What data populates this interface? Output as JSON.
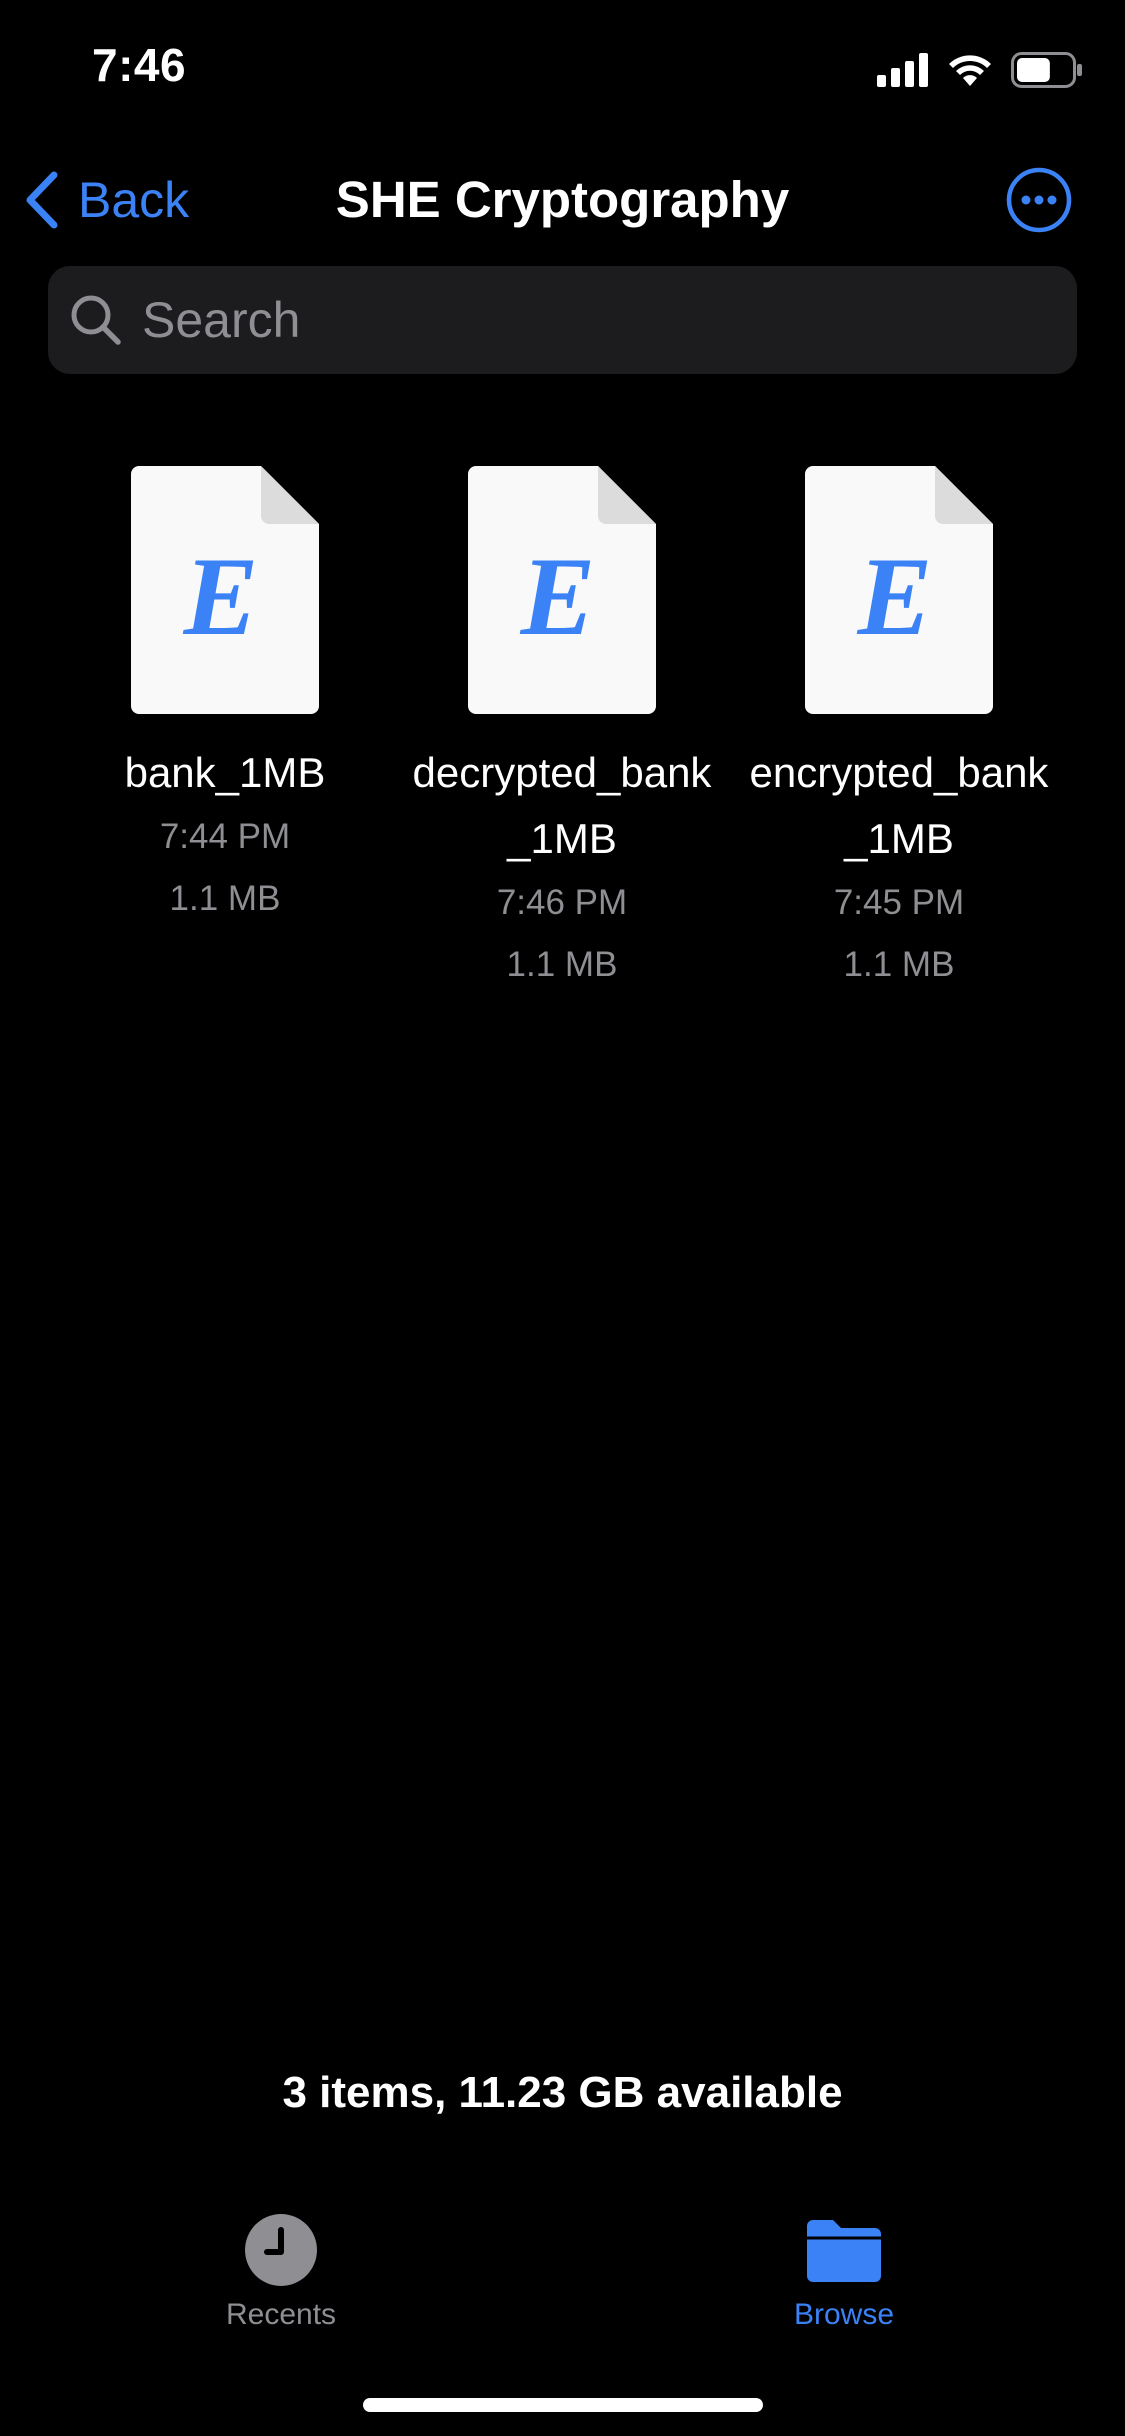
{
  "status_bar": {
    "time": "7:46",
    "battery_level": 0.62,
    "icons": [
      "cellular-signal-icon",
      "wifi-icon",
      "battery-icon"
    ]
  },
  "nav": {
    "back_label": "Back",
    "title": "SHE Cryptography",
    "more_icon": "ellipsis-circle-icon"
  },
  "search": {
    "placeholder": "Search",
    "value": ""
  },
  "files": [
    {
      "name": "bank_1MB",
      "time": "7:44 PM",
      "size": "1.1 MB",
      "icon_letter": "E"
    },
    {
      "name": "decrypted_bank_1MB",
      "time": "7:46 PM",
      "size": "1.1 MB",
      "icon_letter": "E"
    },
    {
      "name": "encrypted_bank_1MB",
      "time": "7:45 PM",
      "size": "1.1 MB",
      "icon_letter": "E"
    }
  ],
  "summary": "3 items, 11.23 GB available",
  "tabs": [
    {
      "label": "Recents",
      "icon": "clock-icon",
      "active": false
    },
    {
      "label": "Browse",
      "icon": "folder-icon",
      "active": true
    }
  ],
  "colors": {
    "accent": "#3b82f6",
    "background": "#000000",
    "secondary_text": "#8e8e93",
    "search_fill": "#1c1c1e",
    "file_page": "#f9f9f9"
  }
}
